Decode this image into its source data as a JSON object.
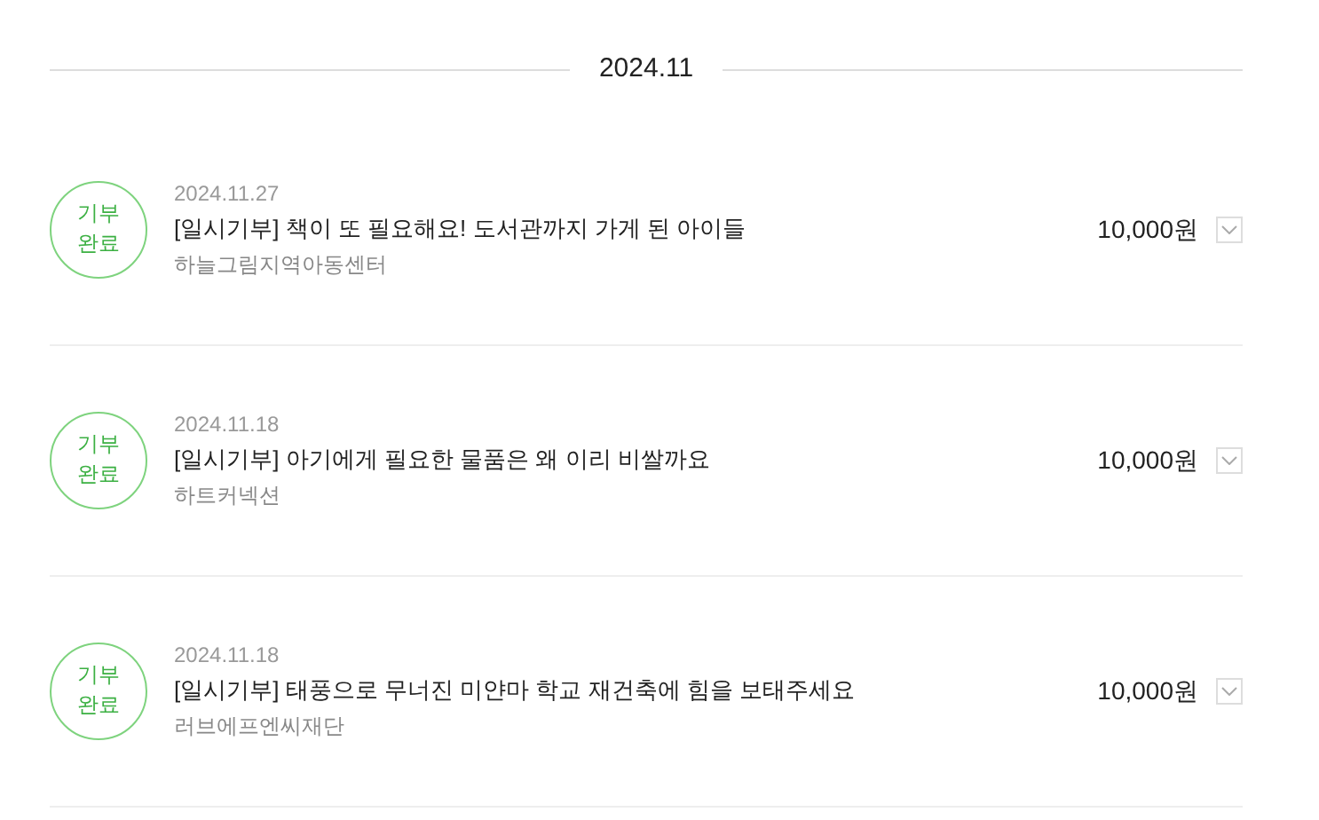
{
  "month_heading": "2024.11",
  "donations": [
    {
      "status": "기부 완료",
      "date": "2024.11.27",
      "title": "[일시기부] 책이 또 필요해요! 도서관까지 가게 된 아이들",
      "organization": "하늘그림지역아동센터",
      "amount": "10,000원",
      "expanded": false
    },
    {
      "status": "기부 완료",
      "date": "2024.11.18",
      "title": "[일시기부] 아기에게 필요한 물품은 왜 이리 비쌀까요",
      "organization": "하트커넥션",
      "amount": "10,000원",
      "expanded": false
    },
    {
      "status": "기부 완료",
      "date": "2024.11.18",
      "title": "[일시기부] 태풍으로 무너진 미얀마 학교 재건축에 힘을 보태주세요",
      "organization": "러브에프엔씨재단",
      "amount": "10,000원",
      "expanded": false
    }
  ]
}
